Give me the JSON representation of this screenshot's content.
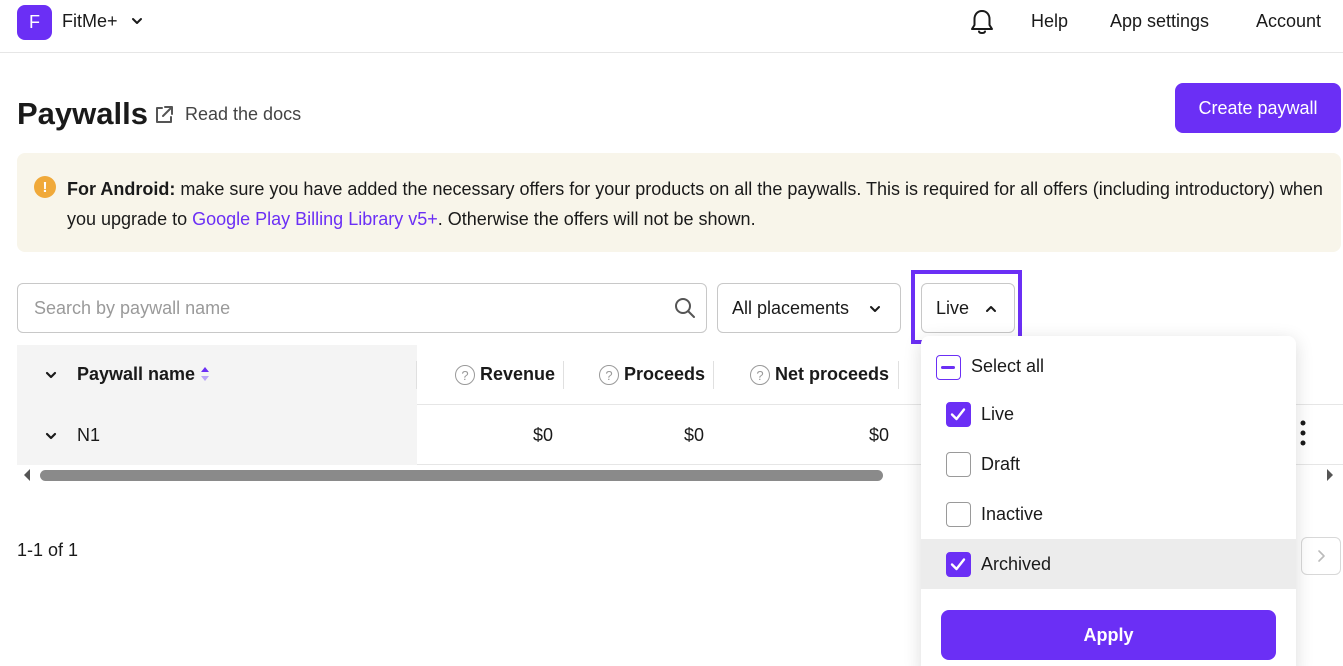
{
  "app": {
    "logo_letter": "F",
    "name": "FitMe+"
  },
  "topnav": {
    "help": "Help",
    "app_settings": "App settings",
    "account": "Account"
  },
  "header": {
    "title": "Paywalls",
    "docs_link": "Read the docs",
    "create_button": "Create paywall"
  },
  "notice": {
    "icon": "!",
    "bold": "For Android:",
    "text_before_link": " make sure you have added the necessary offers for your products on all the paywalls. This is required for all offers (including introductory) when you upgrade to ",
    "link": "Google Play Billing Library v5+",
    "text_after_link": ". Otherwise the offers will not be shown."
  },
  "filters": {
    "search_placeholder": "Search by paywall name",
    "placements": "All placements",
    "status": "Live"
  },
  "table": {
    "columns": {
      "name": "Paywall name",
      "revenue": "Revenue",
      "proceeds": "Proceeds",
      "net_proceeds": "Net proceeds"
    },
    "help_glyph": "?",
    "rows": [
      {
        "name": "N1",
        "revenue": "$0",
        "proceeds": "$0",
        "net_proceeds": "$0"
      }
    ]
  },
  "pagination": {
    "summary": "1-1 of 1"
  },
  "status_dropdown": {
    "select_all": "Select all",
    "options": [
      {
        "label": "Live",
        "checked": true
      },
      {
        "label": "Draft",
        "checked": false
      },
      {
        "label": "Inactive",
        "checked": false
      },
      {
        "label": "Archived",
        "checked": true
      }
    ],
    "apply": "Apply"
  },
  "colors": {
    "accent": "#6b2ff5",
    "notice_bg": "#f8f5ea",
    "warning": "#f0a93a"
  }
}
